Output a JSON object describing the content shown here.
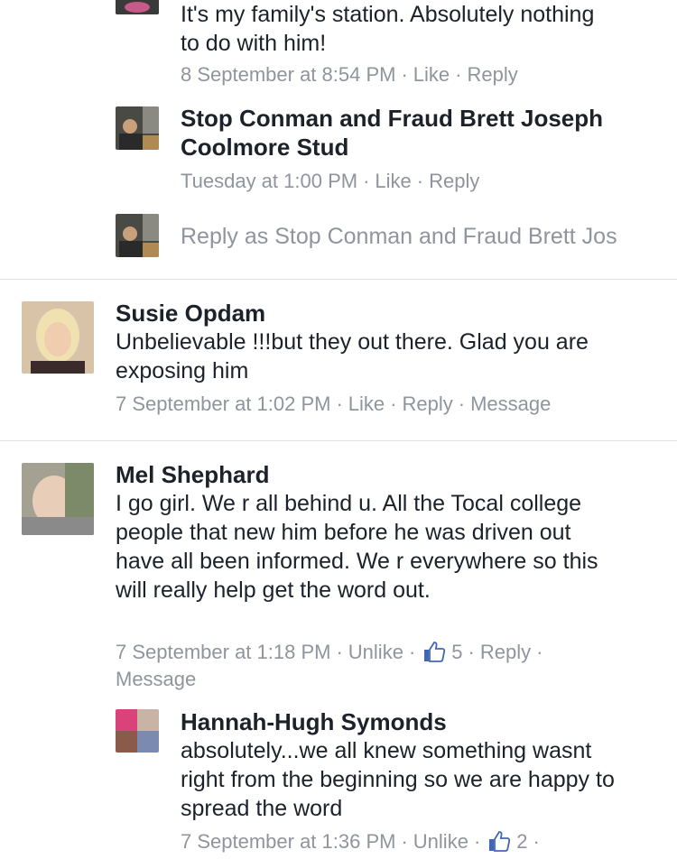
{
  "comments": {
    "top_reply": {
      "text": "It's my family's station. Absolutely nothing to do with him!",
      "timestamp": "8 September at 8:54 PM",
      "like_label": "Like",
      "reply_label": "Reply"
    },
    "stop_conman_reply": {
      "author": "Stop Conman and Fraud Brett Joseph Coolmore Stud",
      "timestamp": "Tuesday at 1:00 PM",
      "like_label": "Like",
      "reply_label": "Reply"
    },
    "reply_as_field": {
      "placeholder": "Reply as Stop Conman and Fraud Brett Jos"
    },
    "susie": {
      "author": "Susie Opdam",
      "text": "Unbelievable !!!but they out there. Glad you are exposing him",
      "timestamp": "7 September at 1:02 PM",
      "like_label": "Like",
      "reply_label": "Reply",
      "message_label": "Message"
    },
    "mel": {
      "author": "Mel Shephard",
      "text": "I go girl. We r all behind u. All the Tocal college people that new him before he was driven out have all been informed. We r everywhere so this will really help get the word out.",
      "timestamp": "7 September at 1:18 PM",
      "unlike_label": "Unlike",
      "like_count": "5",
      "reply_label": "Reply",
      "message_label": "Message"
    },
    "hannah": {
      "author": "Hannah-Hugh Symonds",
      "text": "absolutely...we all knew something wasnt right from the beginning so we are happy to spread the word",
      "timestamp": "7 September at 1:36 PM",
      "unlike_label": "Unlike",
      "like_count": "2"
    }
  },
  "colors": {
    "name_text": "#1d2129",
    "meta_text": "#90949c",
    "like_blue": "#4267b2",
    "divider": "#dddfe2"
  }
}
